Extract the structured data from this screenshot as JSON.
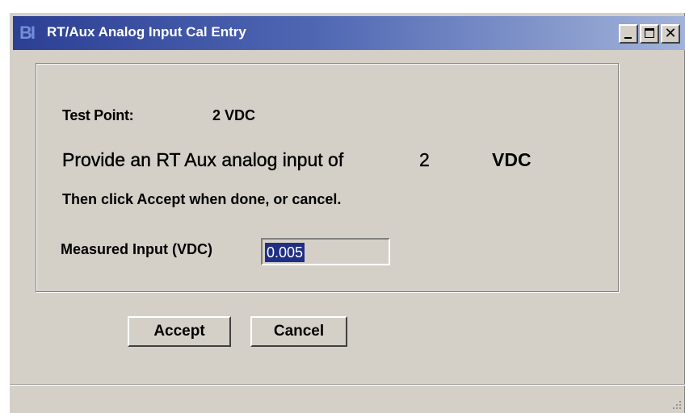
{
  "window": {
    "title": "RT/Aux Analog Input Cal Entry",
    "app_icon_text": "BI",
    "controls": {
      "minimize": "minimize-icon",
      "maximize": "maximize-icon",
      "close": "close-icon"
    }
  },
  "test_point": {
    "label": "Test Point:",
    "value": "2 VDC"
  },
  "prompt": {
    "text": "Provide an RT Aux analog input of",
    "value": "2",
    "unit": "VDC"
  },
  "instruction": "Then click Accept when done, or cancel.",
  "measured": {
    "label": "Measured Input (VDC)",
    "value": "0.005"
  },
  "buttons": {
    "accept": "Accept",
    "cancel": "Cancel"
  },
  "colors": {
    "title_start": "#2c3f94",
    "title_end": "#a2b3d9",
    "face": "#d4d0c8",
    "selection": "#1f2f86"
  }
}
